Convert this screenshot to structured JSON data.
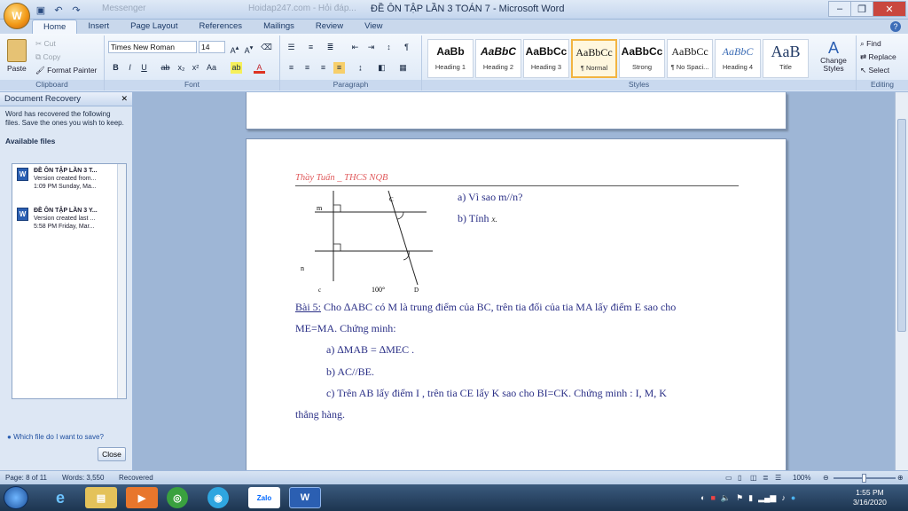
{
  "window": {
    "title": "ĐỀ ÔN TẬP LẦN 3 TOÁN 7 - Microsoft Word",
    "faded_title_1": "Messenger",
    "faded_title_2": "Hoidap247.com - Hỏi đáp..."
  },
  "tabs": [
    "Home",
    "Insert",
    "Page Layout",
    "References",
    "Mailings",
    "Review",
    "View"
  ],
  "ribbon": {
    "clipboard": {
      "label": "Clipboard",
      "paste": "Paste",
      "cut": "Cut",
      "copy": "Copy",
      "format_painter": "Format Painter"
    },
    "font": {
      "label": "Font",
      "font_name": "Times New Roman",
      "font_size": "14"
    },
    "paragraph": {
      "label": "Paragraph"
    },
    "styles": {
      "label": "Styles",
      "items": [
        {
          "preview": "AaBb",
          "name": "Heading 1"
        },
        {
          "preview": "AaBbC",
          "name": "Heading 2"
        },
        {
          "preview": "AaBbCc",
          "name": "Heading 3"
        },
        {
          "preview": "AaBbCc",
          "name": "¶ Normal"
        },
        {
          "preview": "AaBbCc",
          "name": "Strong"
        },
        {
          "preview": "AaBbCc",
          "name": "¶ No Spaci..."
        },
        {
          "preview": "AaBbC",
          "name": "Heading 4"
        },
        {
          "preview": "AaB",
          "name": "Title"
        }
      ],
      "change_styles": "Change Styles"
    },
    "editing": {
      "label": "Editing",
      "find": "Find",
      "replace": "Replace",
      "select": "Select"
    }
  },
  "recovery": {
    "title": "Document Recovery",
    "message": "Word has recovered the following files. Save the ones you wish to keep.",
    "available": "Available files",
    "files": [
      {
        "name": "ĐỀ ÔN TẬP LẦN 3 T...",
        "line2": "Version created from...",
        "line3": "1:09 PM Sunday, Ma..."
      },
      {
        "name": "ĐỀ ÔN TẬP LẦN 3 Y...",
        "line2": "Version created last ...",
        "line3": "5:58 PM Friday, Mar..."
      }
    ],
    "which_file": "Which file do I want to save?",
    "close": "Close"
  },
  "document": {
    "header": "Thầy Tuấn _ THCS NQB",
    "qa": "a) Vì sao m//n?",
    "qb": "b) Tính",
    "qb_var": "x.",
    "fig_m": "m",
    "fig_n": "n",
    "fig_c": "c",
    "fig_d": "D",
    "fig_C": "C",
    "fig_angle": "100°",
    "bai5_label": "Bài 5:",
    "bai5_text": " Cho ∆ABC  có M là trung điểm của BC, trên tia đối của tia MA lấy điểm E sao cho",
    "bai5_line2": "ME=MA. Chứng minh:",
    "p_a": "a) ∆MAB = ∆MEC .",
    "p_b": "b) AC//BE.",
    "p_c": "c) Trên AB lấy điểm I , trên tia CE lấy K sao cho BI=CK. Chứng minh : I, M, K",
    "p_c2": "thẳng hàng."
  },
  "status": {
    "page": "Page: 8 of 11",
    "words": "Words: 3,550",
    "recovered": "Recovered",
    "zoom": "100%"
  },
  "taskbar": {
    "time": "1:55 PM",
    "date": "3/16/2020",
    "zalo": "Zalo"
  }
}
